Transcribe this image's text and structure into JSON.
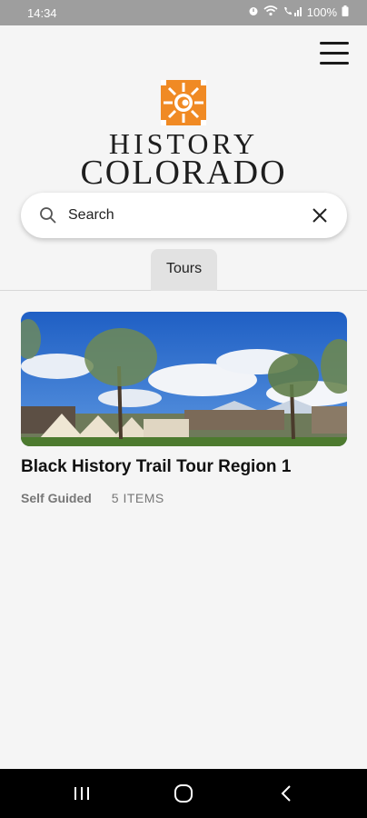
{
  "status_bar": {
    "time": "14:34",
    "battery": "100%",
    "icons": [
      "alarm-icon",
      "wifi-icon",
      "call-signal-icon",
      "battery-icon"
    ]
  },
  "header": {
    "menu_icon": "hamburger-menu-icon",
    "logo": {
      "line1": "HISTORY",
      "line2": "COLORADO",
      "brand_color": "#f08a24"
    }
  },
  "search": {
    "placeholder": "Search",
    "value": "",
    "icon": "search-icon",
    "clear_icon": "close-icon"
  },
  "tabs": [
    {
      "label": "Tours",
      "selected": true
    }
  ],
  "cards": [
    {
      "title": "Black History Trail Tour Region 1",
      "type": "Self Guided",
      "items": "5  ITEMS",
      "image": "photo of canvas tents under trees with mountains and blue sky"
    }
  ],
  "nav_bar": {
    "icons": [
      "recent-apps-icon",
      "home-icon",
      "back-icon"
    ]
  }
}
